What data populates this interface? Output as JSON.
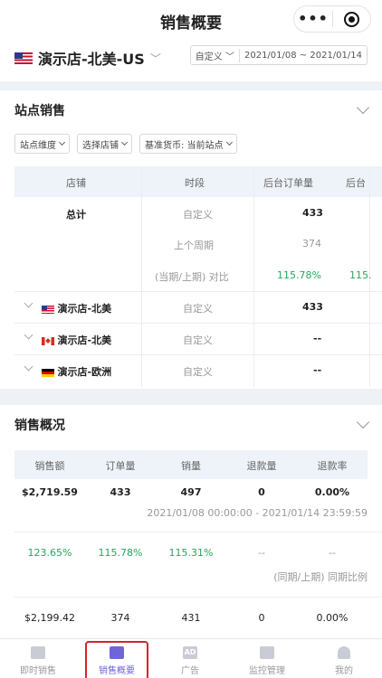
{
  "nav": {
    "title": "销售概要"
  },
  "store": {
    "name": "演示店-北美-US",
    "date_mode": "自定义",
    "date_range": "2021/01/08 ~ 2021/01/14"
  },
  "site_sales": {
    "title": "站点销售",
    "filters": [
      "站点维度",
      "选择店铺",
      "基准货币: 当前站点"
    ],
    "columns": [
      "店铺",
      "时段",
      "后台订单量",
      "后台"
    ],
    "total": {
      "label": "总计",
      "rows": [
        {
          "period": "自定义",
          "orders": "433"
        },
        {
          "period": "上个周期",
          "orders": "374"
        },
        {
          "period": "(当期/上期) 对比",
          "orders": "115.78%",
          "next": "115."
        }
      ]
    },
    "stores": [
      {
        "flag": "us",
        "name": "演示店-北美",
        "period": "自定义",
        "orders": "433"
      },
      {
        "flag": "ca",
        "name": "演示店-北美",
        "period": "自定义",
        "orders": "--"
      },
      {
        "flag": "de",
        "name": "演示店-欧洲",
        "period": "自定义",
        "orders": "--"
      }
    ]
  },
  "overview": {
    "title": "销售概况",
    "columns": [
      "销售额",
      "订单量",
      "销量",
      "退款量",
      "退款率"
    ],
    "current": [
      "$2,719.59",
      "433",
      "497",
      "0",
      "0.00%"
    ],
    "current_range": "2021/01/08 00:00:00 - 2021/01/14 23:59:59",
    "compare": [
      "123.65%",
      "115.78%",
      "115.31%",
      "--",
      "--"
    ],
    "compare_label": "(同期/上期) 同期比例",
    "previous": [
      "$2,199.42",
      "374",
      "431",
      "0",
      "0.00%"
    ]
  },
  "tabs": [
    {
      "label": "即时销售"
    },
    {
      "label": "销售概要"
    },
    {
      "label": "广告",
      "icon_text": "AD"
    },
    {
      "label": "监控管理"
    },
    {
      "label": "我的"
    }
  ],
  "colors": {
    "accent": "#6e66d8",
    "positive": "#27a55b",
    "highlight": "#d9212c"
  }
}
